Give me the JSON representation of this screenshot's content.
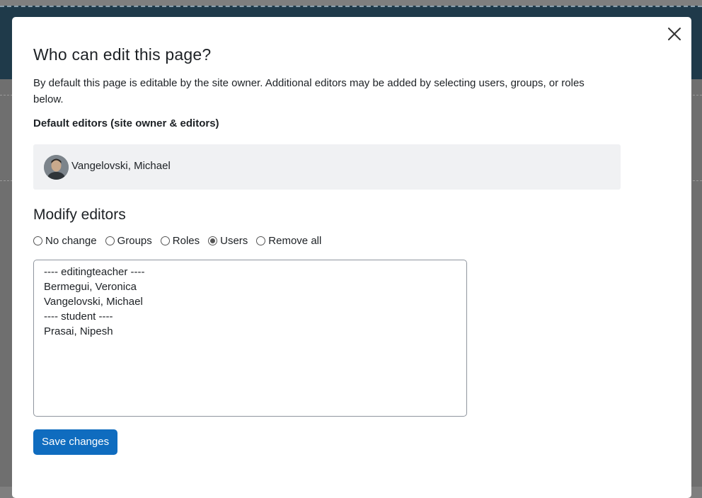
{
  "dialog": {
    "title": "Who can edit this page?",
    "description": "By default this page is editable by the site owner. Additional editors may be added by selecting users, groups, or roles below.",
    "default_editors_label": "Default editors (site owner & editors)",
    "default_editors": [
      {
        "name": "Vangelovski, Michael",
        "avatar": "user-photo"
      }
    ],
    "modify_title": "Modify editors",
    "options": [
      {
        "label": "No change",
        "checked": false
      },
      {
        "label": "Groups",
        "checked": false
      },
      {
        "label": "Roles",
        "checked": false
      },
      {
        "label": "Users",
        "checked": true
      },
      {
        "label": "Remove all",
        "checked": false
      }
    ],
    "list_items": [
      "---- editingteacher ----",
      "Bermegui, Veronica",
      "Vangelovski, Michael",
      "---- student ----",
      "Prasai, Nipesh"
    ],
    "save_label": "Save changes",
    "close_icon": "close-icon"
  },
  "colors": {
    "primary": "#0f6cbf",
    "editor_box_bg": "#f0f1f3",
    "overlay": "#7f7f7f"
  }
}
